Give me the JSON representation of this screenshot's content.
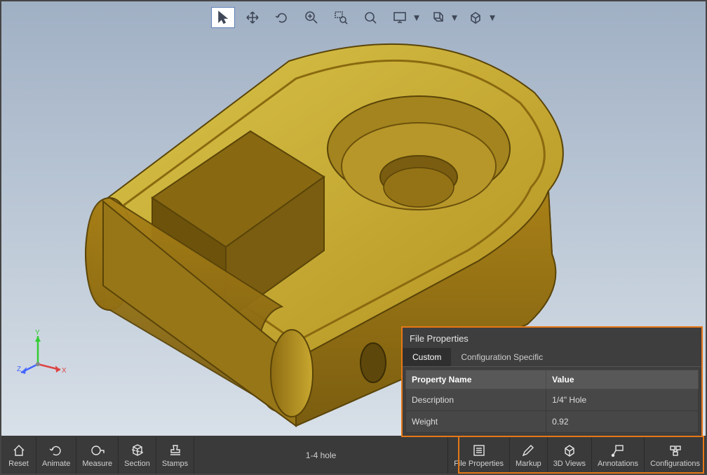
{
  "toolbar": {
    "tools": [
      {
        "name": "select-tool",
        "dropdown": false,
        "selected": true
      },
      {
        "name": "pan-tool",
        "dropdown": false
      },
      {
        "name": "rotate-tool",
        "dropdown": false
      },
      {
        "name": "zoom-in-tool",
        "dropdown": false
      },
      {
        "name": "zoom-area-tool",
        "dropdown": false
      },
      {
        "name": "zoom-fit-tool",
        "dropdown": false
      },
      {
        "name": "projection-tool",
        "dropdown": true
      },
      {
        "name": "orientation-tool",
        "dropdown": true
      },
      {
        "name": "view-cube-tool",
        "dropdown": true
      }
    ]
  },
  "triad": {
    "x": "X",
    "y": "Y",
    "z": "Z"
  },
  "properties_panel": {
    "title": "File Properties",
    "tabs": [
      {
        "label": "Custom",
        "active": true
      },
      {
        "label": "Configuration Specific",
        "active": false
      }
    ],
    "headers": {
      "name": "Property Name",
      "value": "Value"
    },
    "rows": [
      {
        "name": "Description",
        "value": "1/4\" Hole"
      },
      {
        "name": "Weight",
        "value": "0.92"
      }
    ]
  },
  "status_text": "1-4 hole",
  "bottom_left": [
    {
      "name": "reset-button",
      "label": "Reset"
    },
    {
      "name": "animate-button",
      "label": "Animate"
    },
    {
      "name": "measure-button",
      "label": "Measure"
    },
    {
      "name": "section-button",
      "label": "Section"
    },
    {
      "name": "stamps-button",
      "label": "Stamps"
    }
  ],
  "bottom_right": [
    {
      "name": "file-properties-button",
      "label": "File Properties"
    },
    {
      "name": "markup-button",
      "label": "Markup"
    },
    {
      "name": "3d-views-button",
      "label": "3D Views"
    },
    {
      "name": "annotations-button",
      "label": "Annotations"
    },
    {
      "name": "configurations-button",
      "label": "Configurations"
    }
  ]
}
